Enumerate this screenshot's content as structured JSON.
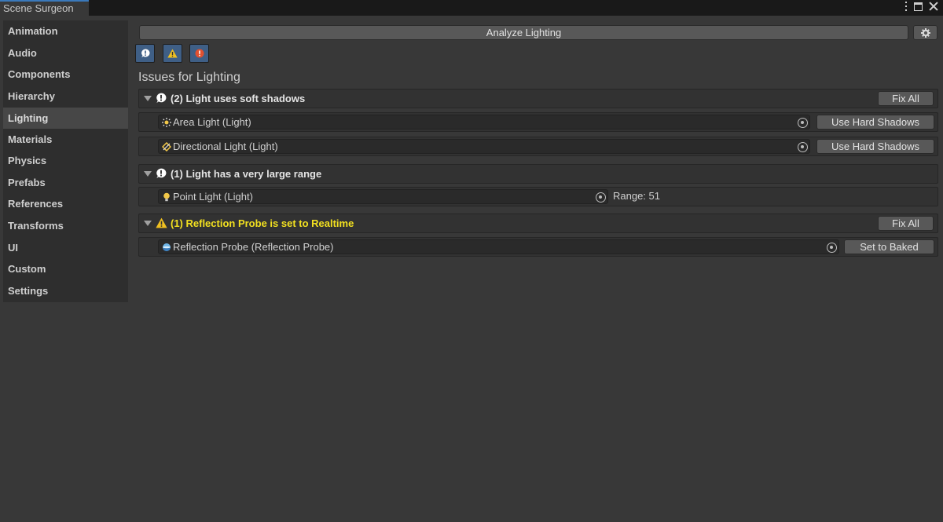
{
  "window": {
    "tab_title": "Scene Surgeon"
  },
  "sidebar": {
    "items": [
      {
        "label": "Animation"
      },
      {
        "label": "Audio"
      },
      {
        "label": "Components"
      },
      {
        "label": "Hierarchy"
      },
      {
        "label": "Lighting",
        "active": true
      },
      {
        "label": "Materials"
      },
      {
        "label": "Physics"
      },
      {
        "label": "Prefabs"
      },
      {
        "label": "References"
      },
      {
        "label": "Transforms"
      },
      {
        "label": "UI"
      },
      {
        "label": "Custom"
      },
      {
        "label": "Settings"
      }
    ]
  },
  "toolbar": {
    "analyze_label": "Analyze Lighting",
    "settings_icon": "gear-icon"
  },
  "filters": [
    {
      "icon": "info-icon",
      "color": "#ffffff"
    },
    {
      "icon": "warning-icon",
      "color": "#f0c020"
    },
    {
      "icon": "error-icon",
      "color": "#e05030"
    }
  ],
  "main": {
    "heading": "Issues for Lighting",
    "groups": [
      {
        "severity": "info",
        "title": "(2) Light uses soft shadows",
        "fix_all_label": "Fix All",
        "items": [
          {
            "object": "Area Light (Light)",
            "icon": "area-light-icon",
            "action": "Use Hard Shadows"
          },
          {
            "object": "Directional Light (Light)",
            "icon": "directional-light-icon",
            "action": "Use Hard Shadows"
          }
        ]
      },
      {
        "severity": "info",
        "title": "(1) Light has a very large range",
        "items": [
          {
            "object": "Point Light (Light)",
            "icon": "point-light-icon",
            "extra": "Range: 51"
          }
        ]
      },
      {
        "severity": "warning",
        "title": "(1) Reflection Probe is set to Realtime",
        "fix_all_label": "Fix All",
        "items": [
          {
            "object": "Reflection Probe (Reflection Probe)",
            "icon": "reflection-probe-icon",
            "action": "Set to Baked"
          }
        ]
      }
    ]
  },
  "colors": {
    "accent": "#3a79bb",
    "warning_text": "#f2e020",
    "filter_bg": "#3f5f86"
  }
}
